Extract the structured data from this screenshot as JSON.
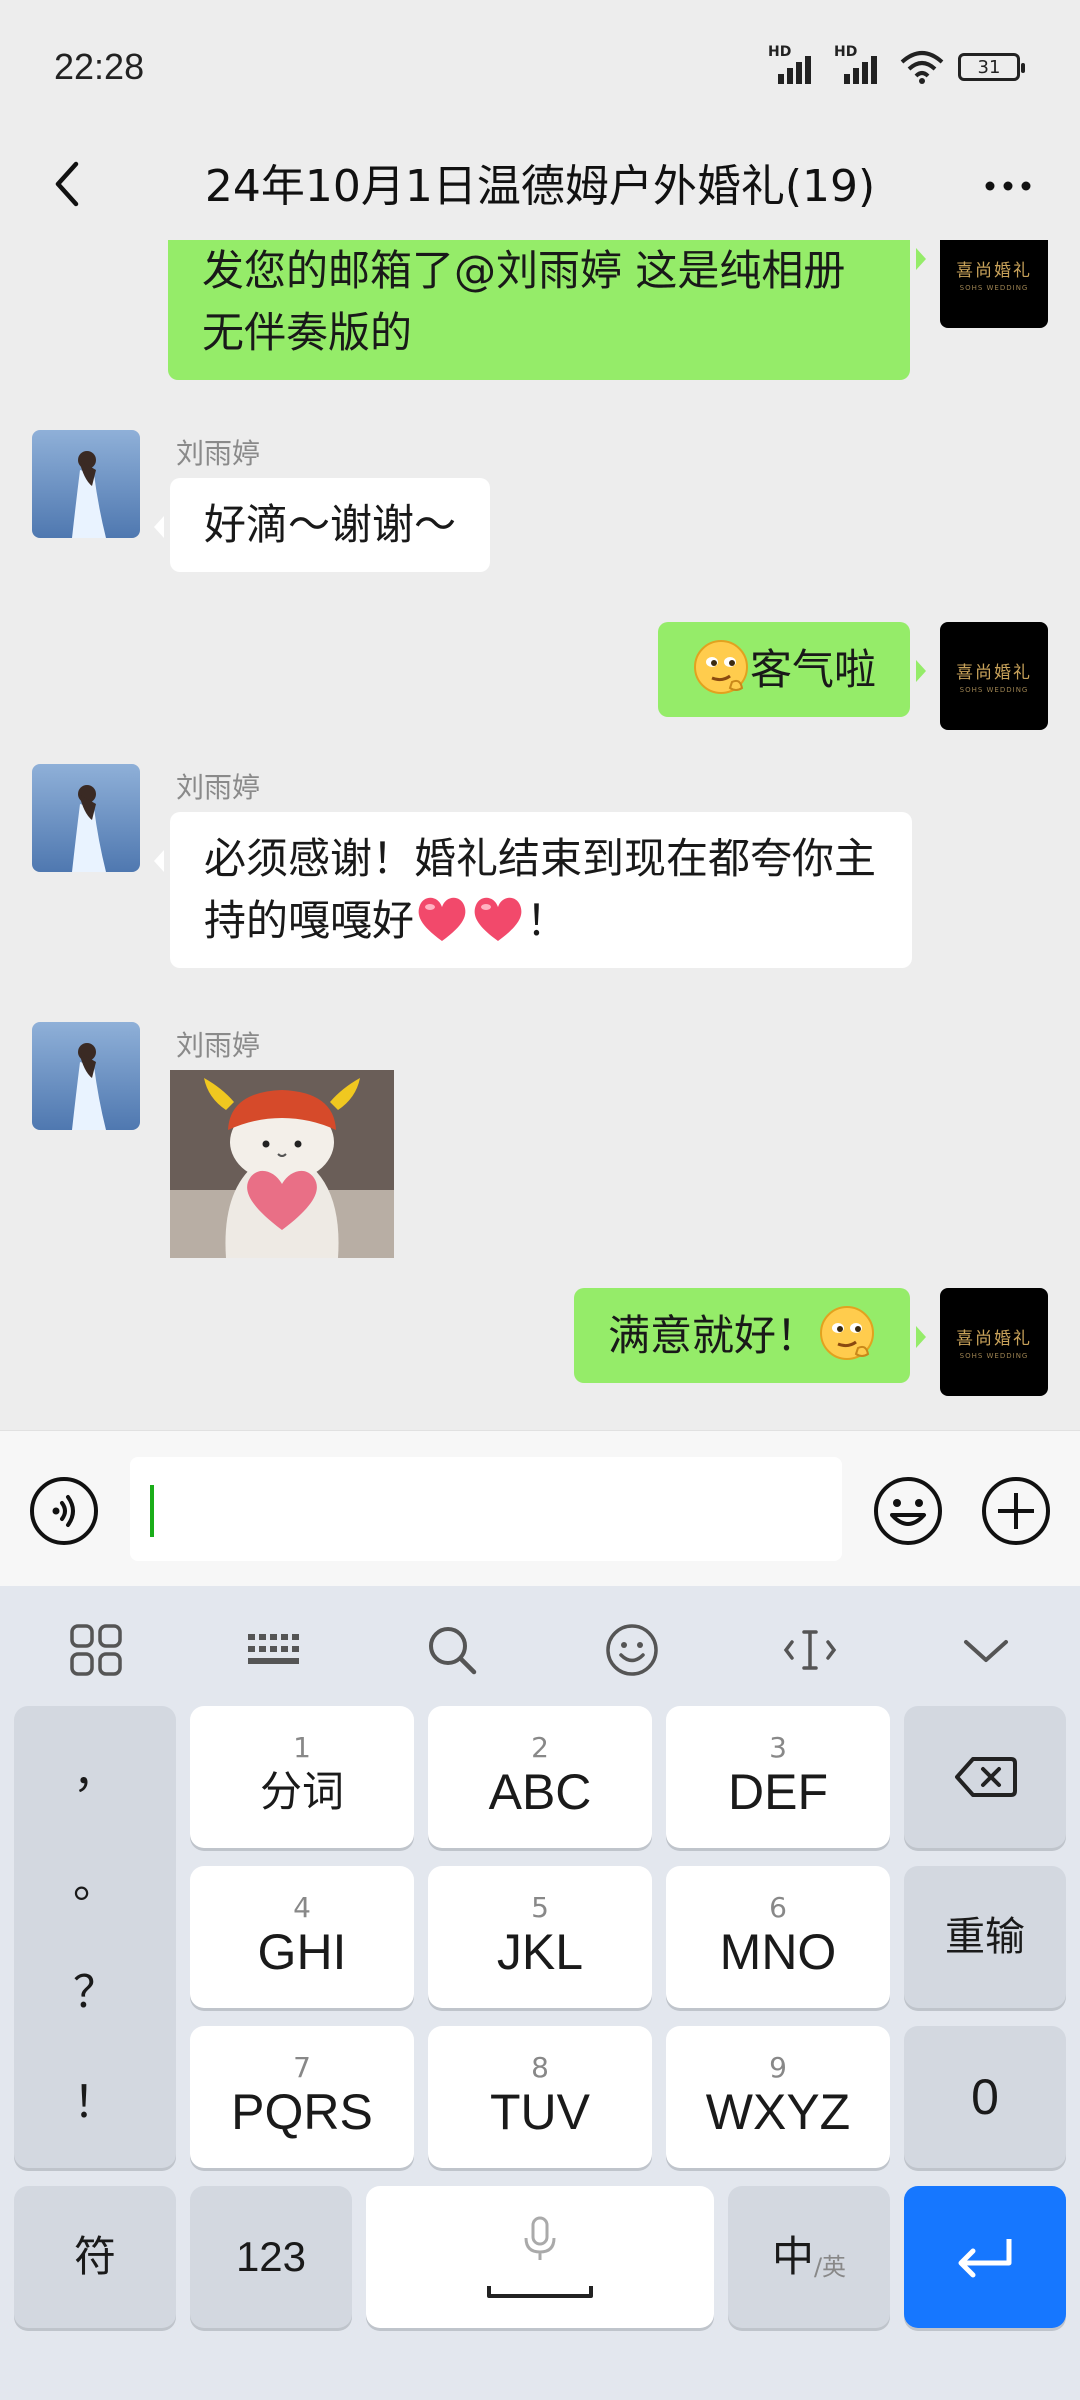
{
  "status_bar": {
    "time": "22:28",
    "signal1_label": "HD",
    "signal2_label": "HD",
    "battery": "31"
  },
  "header": {
    "title": "24年10月1日温德姆户外婚礼(19)"
  },
  "avatars": {
    "right_logo_main": "喜尚婚礼",
    "right_logo_sub": "SOHS WEDDING"
  },
  "messages": [
    {
      "side": "right",
      "text": "发您的邮箱了@刘雨婷  这是纯相册无伴奏版的"
    },
    {
      "side": "left",
      "sender": "刘雨婷",
      "text": "好滴～谢谢～"
    },
    {
      "side": "right",
      "text": "客气啦",
      "emoji_before": "smirk-emoji"
    },
    {
      "side": "left",
      "sender": "刘雨婷",
      "text_part1": "必须感谢！婚礼结束到现在都夸你主持的嘎嘎好",
      "text_part2": "！"
    },
    {
      "side": "left",
      "sender": "刘雨婷",
      "type": "sticker",
      "sticker": "cat-holding-heart"
    },
    {
      "side": "right",
      "text": "满意就好！",
      "emoji_after": "smirk-emoji"
    }
  ],
  "input_bar": {
    "value": ""
  },
  "keyboard": {
    "punctuation": [
      "，",
      "。",
      "？",
      "！"
    ],
    "keys": [
      {
        "num": "1",
        "label": "分词"
      },
      {
        "num": "2",
        "label": "ABC"
      },
      {
        "num": "3",
        "label": "DEF"
      },
      {
        "num": "4",
        "label": "GHI"
      },
      {
        "num": "5",
        "label": "JKL"
      },
      {
        "num": "6",
        "label": "MNO"
      },
      {
        "num": "7",
        "label": "PQRS"
      },
      {
        "num": "8",
        "label": "TUV"
      },
      {
        "num": "9",
        "label": "WXYZ"
      }
    ],
    "reinput": "重输",
    "zero": "0",
    "symbols": "符",
    "numbers": "123",
    "lang_main": "中",
    "lang_alt": "/英"
  },
  "colors": {
    "my_bubble": "#95ec69",
    "their_bubble": "#ffffff",
    "enter_key": "#1677ff"
  }
}
